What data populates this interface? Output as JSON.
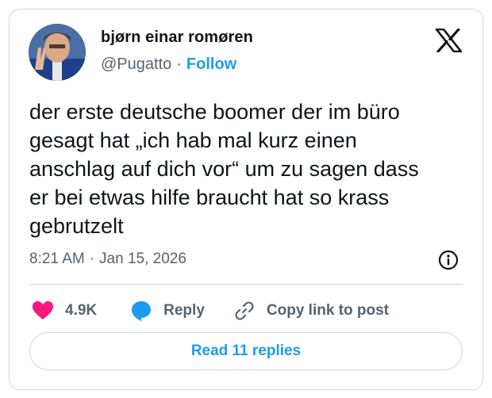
{
  "tweet": {
    "author_name": "bjørn einar romøren",
    "handle": "@Pugatto",
    "separator": "·",
    "follow_label": "Follow",
    "text": "der erste deutsche boomer der im büro\ngesagt hat „ich hab mal kurz einen\nanschlag auf dich vor“ um zu sagen dass\ner bei etwas hilfe braucht hat so krass\ngebrutzelt",
    "time": "8:21 AM",
    "date": "Jan 15, 2026"
  },
  "actions": {
    "like_count": "4.9K",
    "reply_label": "Reply",
    "copy_label": "Copy link to post"
  },
  "footer": {
    "read_replies_label": "Read 11 replies"
  },
  "icons": {
    "brand": "x-logo-icon",
    "info": "info-icon",
    "like": "heart-icon",
    "reply": "speech-bubble-icon",
    "copy": "link-icon"
  },
  "colors": {
    "accent": "#1d9bf0",
    "like": "#f91880",
    "muted_text": "#536471",
    "border": "#cfd9de"
  }
}
